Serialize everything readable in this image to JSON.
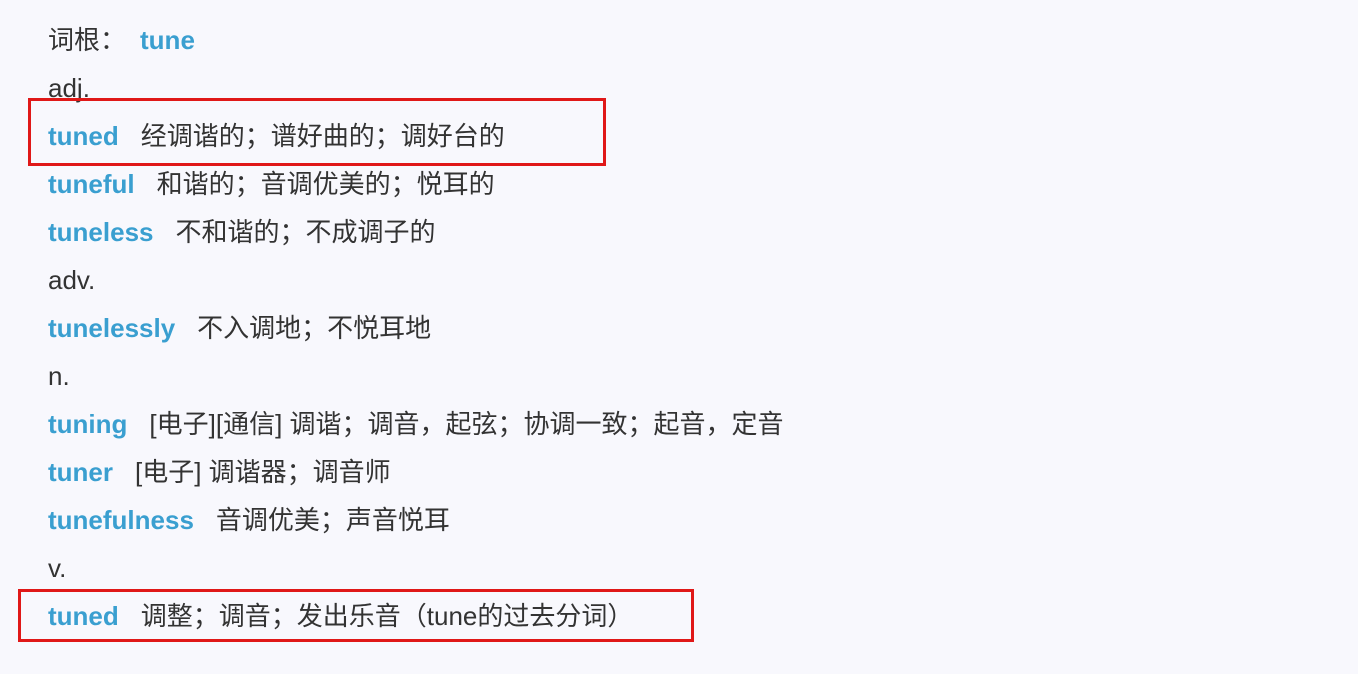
{
  "root": {
    "label": "词根：",
    "word": "tune"
  },
  "groups": [
    {
      "pos": "adj.",
      "entries": [
        {
          "word": "tuned",
          "def": "经调谐的；谱好曲的；调好台的"
        },
        {
          "word": "tuneful",
          "def": "和谐的；音调优美的；悦耳的"
        },
        {
          "word": "tuneless",
          "def": "不和谐的；不成调子的"
        }
      ]
    },
    {
      "pos": "adv.",
      "entries": [
        {
          "word": "tunelessly",
          "def": "不入调地；不悦耳地"
        }
      ]
    },
    {
      "pos": "n.",
      "entries": [
        {
          "word": "tuning",
          "def": "[电子][通信] 调谐；调音，起弦；协调一致；起音，定音"
        },
        {
          "word": "tuner",
          "def": "[电子] 调谐器；调音师"
        },
        {
          "word": "tunefulness",
          "def": "音调优美；声音悦耳"
        }
      ]
    },
    {
      "pos": "v.",
      "entries": [
        {
          "word": "tuned",
          "def": "调整；调音；发出乐音（tune的过去分词）"
        }
      ]
    }
  ],
  "colors": {
    "word": "#3a9fd0",
    "text": "#333333",
    "highlight": "#e01818",
    "background": "#f8f8fd"
  }
}
